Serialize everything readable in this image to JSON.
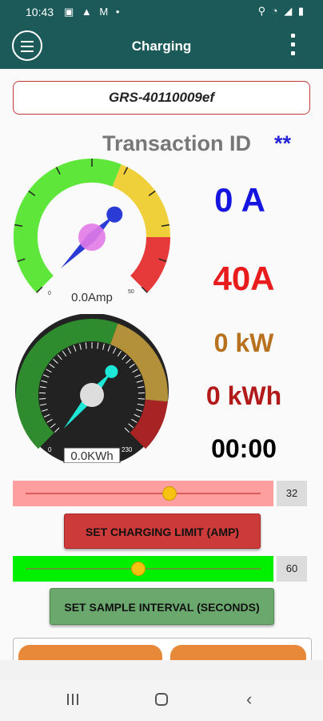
{
  "status_bar": {
    "time": "10:43",
    "left_icons": [
      "image-icon",
      "warning-icon",
      "gmail-icon",
      "dot-icon"
    ],
    "left_glyphs": "▣ ▲ M •",
    "right_icons": [
      "location-icon",
      "wifi-icon",
      "signal-icon",
      "battery-icon"
    ],
    "right_glyphs": "⚲ ◔ ◢ ▮"
  },
  "app_bar": {
    "title": "Charging",
    "menu_icon": "hamburger-icon",
    "overflow_icon": "overflow-menu-icon"
  },
  "charger": {
    "id": "GRS-40110009ef",
    "transaction_label": "Transaction ID",
    "transaction_value": "**"
  },
  "amp_gauge": {
    "min_label": "0",
    "max_label": "50",
    "readout": "0.0Amp",
    "value": 0,
    "colors": {
      "green": "#5fe63b",
      "yellow": "#efd03a",
      "red": "#e63a3a",
      "needle": "#2b3bd6",
      "hub": "#e27ae6"
    }
  },
  "kwh_gauge": {
    "min_label": "0",
    "max_label": "230",
    "readout": "0.0KWh",
    "value": 0,
    "colors": {
      "green": "#2e8b2e",
      "olive": "#b3913a",
      "red": "#a82424",
      "dial": "#222222",
      "needle": "#1de8d8"
    }
  },
  "readings": {
    "current": "0 A",
    "max_current": "40A",
    "power": "0 kW",
    "energy": "0 kWh",
    "elapsed": "00:00"
  },
  "charging_limit": {
    "value": "32",
    "fraction": 0.62,
    "track_color": "#ff9e9e",
    "button_label": "SET CHARGING LIMIT (AMP)"
  },
  "sample_interval": {
    "value": "60",
    "fraction": 0.48,
    "track_color": "#00f000",
    "button_label": "SET SAMPLE INTERVAL (SECONDS)"
  },
  "nav": {
    "recent_icon": "recent-apps-icon",
    "home_icon": "home-icon",
    "back_icon": "back-icon"
  }
}
